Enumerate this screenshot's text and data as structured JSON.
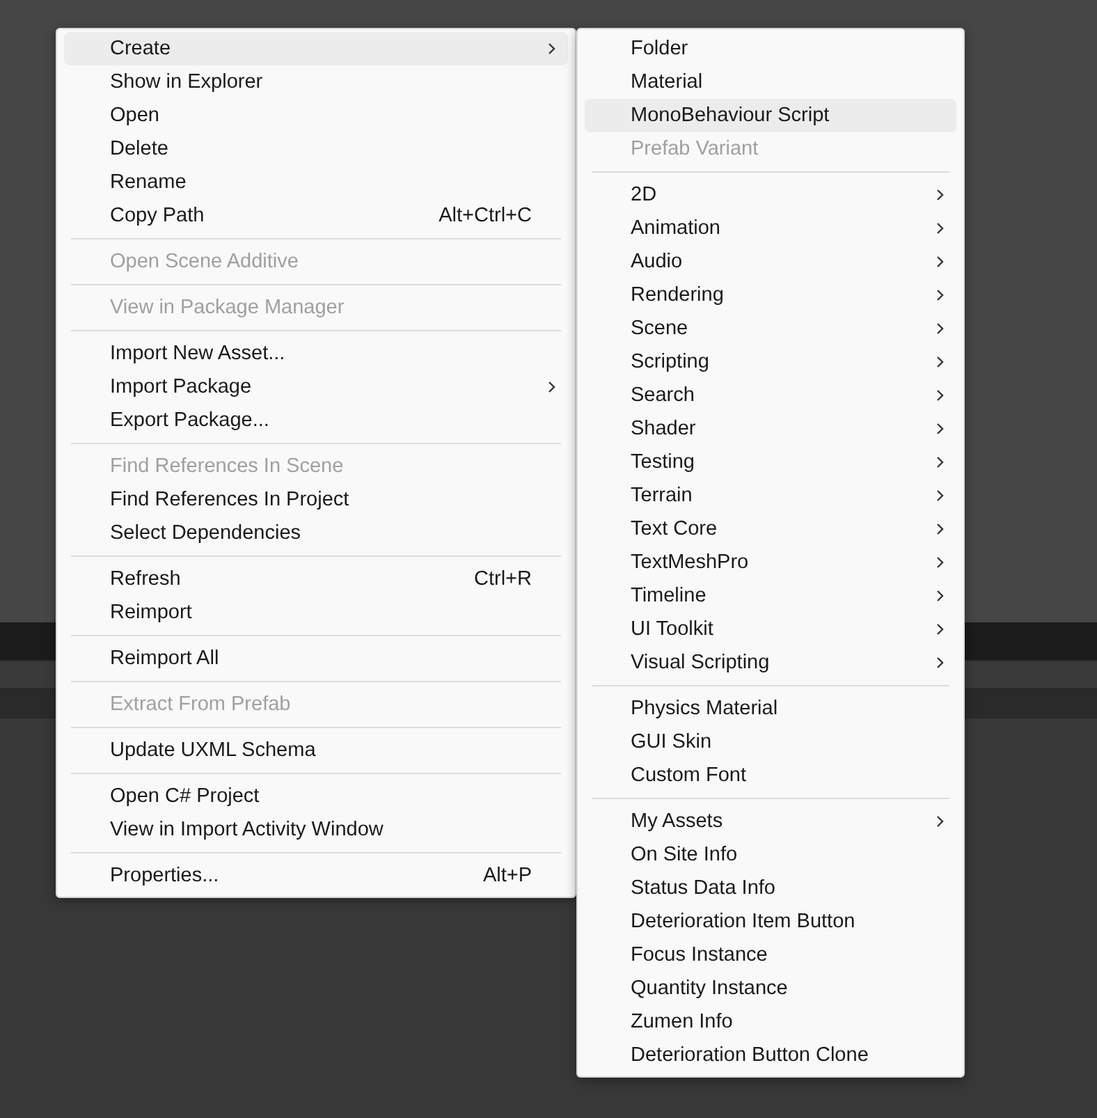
{
  "menus": [
    {
      "items": [
        {
          "kind": "item",
          "label": "Create",
          "submenu": true,
          "selected": true
        },
        {
          "kind": "item",
          "label": "Show in Explorer"
        },
        {
          "kind": "item",
          "label": "Open"
        },
        {
          "kind": "item",
          "label": "Delete"
        },
        {
          "kind": "item",
          "label": "Rename"
        },
        {
          "kind": "item",
          "label": "Copy Path",
          "shortcut": "Alt+Ctrl+C"
        },
        {
          "kind": "separator"
        },
        {
          "kind": "item",
          "label": "Open Scene Additive",
          "disabled": true
        },
        {
          "kind": "separator"
        },
        {
          "kind": "item",
          "label": "View in Package Manager",
          "disabled": true
        },
        {
          "kind": "separator"
        },
        {
          "kind": "item",
          "label": "Import New Asset..."
        },
        {
          "kind": "item",
          "label": "Import Package",
          "submenu": true
        },
        {
          "kind": "item",
          "label": "Export Package..."
        },
        {
          "kind": "separator"
        },
        {
          "kind": "item",
          "label": "Find References In Scene",
          "disabled": true
        },
        {
          "kind": "item",
          "label": "Find References In Project"
        },
        {
          "kind": "item",
          "label": "Select Dependencies"
        },
        {
          "kind": "separator"
        },
        {
          "kind": "item",
          "label": "Refresh",
          "shortcut": "Ctrl+R"
        },
        {
          "kind": "item",
          "label": "Reimport"
        },
        {
          "kind": "separator"
        },
        {
          "kind": "item",
          "label": "Reimport All"
        },
        {
          "kind": "separator"
        },
        {
          "kind": "item",
          "label": "Extract From Prefab",
          "disabled": true
        },
        {
          "kind": "separator"
        },
        {
          "kind": "item",
          "label": "Update UXML Schema"
        },
        {
          "kind": "separator"
        },
        {
          "kind": "item",
          "label": "Open C# Project"
        },
        {
          "kind": "item",
          "label": "View in Import Activity Window"
        },
        {
          "kind": "separator"
        },
        {
          "kind": "item",
          "label": "Properties...",
          "shortcut": "Alt+P"
        }
      ]
    },
    {
      "items": [
        {
          "kind": "item",
          "label": "Folder"
        },
        {
          "kind": "item",
          "label": "Material"
        },
        {
          "kind": "item",
          "label": "MonoBehaviour Script",
          "selected": true
        },
        {
          "kind": "item",
          "label": "Prefab Variant",
          "disabled": true
        },
        {
          "kind": "separator"
        },
        {
          "kind": "item",
          "label": "2D",
          "submenu": true
        },
        {
          "kind": "item",
          "label": "Animation",
          "submenu": true
        },
        {
          "kind": "item",
          "label": "Audio",
          "submenu": true
        },
        {
          "kind": "item",
          "label": "Rendering",
          "submenu": true
        },
        {
          "kind": "item",
          "label": "Scene",
          "submenu": true
        },
        {
          "kind": "item",
          "label": "Scripting",
          "submenu": true
        },
        {
          "kind": "item",
          "label": "Search",
          "submenu": true
        },
        {
          "kind": "item",
          "label": "Shader",
          "submenu": true
        },
        {
          "kind": "item",
          "label": "Testing",
          "submenu": true
        },
        {
          "kind": "item",
          "label": "Terrain",
          "submenu": true
        },
        {
          "kind": "item",
          "label": "Text Core",
          "submenu": true
        },
        {
          "kind": "item",
          "label": "TextMeshPro",
          "submenu": true
        },
        {
          "kind": "item",
          "label": "Timeline",
          "submenu": true
        },
        {
          "kind": "item",
          "label": "UI Toolkit",
          "submenu": true
        },
        {
          "kind": "item",
          "label": "Visual Scripting",
          "submenu": true
        },
        {
          "kind": "separator"
        },
        {
          "kind": "item",
          "label": "Physics Material"
        },
        {
          "kind": "item",
          "label": "GUI Skin"
        },
        {
          "kind": "item",
          "label": "Custom Font"
        },
        {
          "kind": "separator"
        },
        {
          "kind": "item",
          "label": "My Assets",
          "submenu": true
        },
        {
          "kind": "item",
          "label": "On Site Info"
        },
        {
          "kind": "item",
          "label": "Status Data Info"
        },
        {
          "kind": "item",
          "label": "Deterioration Item Button"
        },
        {
          "kind": "item",
          "label": "Focus Instance"
        },
        {
          "kind": "item",
          "label": "Quantity Instance"
        },
        {
          "kind": "item",
          "label": "Zumen Info"
        },
        {
          "kind": "item",
          "label": "Deterioration Button Clone"
        }
      ]
    }
  ]
}
